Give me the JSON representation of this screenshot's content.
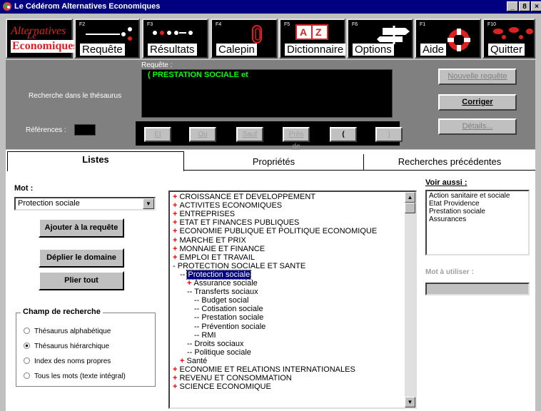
{
  "window": {
    "title": "Le Cédérom Alternatives Economiques",
    "buttons": [
      "_",
      "8",
      "×"
    ]
  },
  "toolbar": {
    "logo": {
      "top": "Alternatives",
      "bottom": "Economiques",
      "overlay": "Le Cédérom"
    },
    "items": [
      {
        "fkey": "F2",
        "label": "Requête"
      },
      {
        "fkey": "F3",
        "label": "Résultats"
      },
      {
        "fkey": "F4",
        "label": "Calepin"
      },
      {
        "fkey": "F5",
        "label": "Dictionnaire"
      },
      {
        "fkey": "F6",
        "label": "Options"
      },
      {
        "fkey": "F1",
        "label": "Aide"
      },
      {
        "fkey": "F10",
        "label": "Quitter"
      }
    ]
  },
  "query": {
    "label": "Requête :",
    "text": "(   PRESTATION SOCIALE    et",
    "thesaurus_label": "Recherche dans le thésaurus",
    "references_label": "Références :",
    "operators": [
      "Et",
      "Ou",
      "Sauf",
      "Près de",
      "(",
      ")"
    ],
    "buttons": {
      "new": "Nouvelle requête",
      "correct": "Corriger",
      "details": "Détails..."
    }
  },
  "tabs": [
    "Listes",
    "Propriétés",
    "Recherches précédentes"
  ],
  "left": {
    "mot_label": "Mot :",
    "mot_value": "Protection sociale",
    "add_button": "Ajouter à la requête",
    "expand_button": "Déplier le domaine",
    "collapse_button": "Plier tout",
    "field_title": "Champ de recherche",
    "fields": [
      {
        "label": "Thésaurus alphabétique",
        "checked": false
      },
      {
        "label": "Thésaurus hiérarchique",
        "checked": true
      },
      {
        "label": "Index des noms propres",
        "checked": false
      },
      {
        "label": "Tous les mots (texte intégral)",
        "checked": false
      }
    ]
  },
  "tree": [
    {
      "text": "CROISSANCE ET DEVELOPPEMENT",
      "prefix": "+",
      "indent": 0
    },
    {
      "text": "ACTIVITES ECONOMIQUES",
      "prefix": "+",
      "indent": 0
    },
    {
      "text": "ENTREPRISES",
      "prefix": "+",
      "indent": 0
    },
    {
      "text": "ETAT ET FINANCES PUBLIQUES",
      "prefix": "+",
      "indent": 0
    },
    {
      "text": "ECONOMIE PUBLIQUE ET POLITIQUE ECONOMIQUE",
      "prefix": "+",
      "indent": 0
    },
    {
      "text": "MARCHE ET PRIX",
      "prefix": "+",
      "indent": 0
    },
    {
      "text": "MONNAIE ET FINANCE",
      "prefix": "+",
      "indent": 0
    },
    {
      "text": "EMPLOI ET TRAVAIL",
      "prefix": "+",
      "indent": 0
    },
    {
      "text": "PROTECTION SOCIALE ET SANTE",
      "prefix": "-",
      "indent": 0
    },
    {
      "text": "Protection sociale",
      "prefix": "--",
      "indent": 1,
      "selected": true
    },
    {
      "text": "Assurance sociale",
      "prefix": "+",
      "indent": 2
    },
    {
      "text": "Transferts sociaux",
      "prefix": "--",
      "indent": 2
    },
    {
      "text": "Budget social",
      "prefix": "--",
      "indent": 3
    },
    {
      "text": "Cotisation sociale",
      "prefix": "--",
      "indent": 3
    },
    {
      "text": "Prestation sociale",
      "prefix": "--",
      "indent": 3
    },
    {
      "text": "Prévention sociale",
      "prefix": "--",
      "indent": 3
    },
    {
      "text": "RMI",
      "prefix": "--",
      "indent": 3
    },
    {
      "text": "Droits sociaux",
      "prefix": "--",
      "indent": 2
    },
    {
      "text": "Politique sociale",
      "prefix": "--",
      "indent": 2
    },
    {
      "text": "Santé",
      "prefix": "+",
      "indent": 1
    },
    {
      "text": "ECONOMIE ET RELATIONS INTERNATIONALES",
      "prefix": "+",
      "indent": 0
    },
    {
      "text": "REVENU ET CONSOMMATION",
      "prefix": "+",
      "indent": 0
    },
    {
      "text": "SCIENCE ECONOMIQUE",
      "prefix": "+",
      "indent": 0
    }
  ],
  "right": {
    "see_also_label": "Voir aussi :",
    "see_also": [
      "Action sanitaire et sociale",
      "Etat Providence",
      "Prestation sociale",
      "Assurances"
    ],
    "use_label": "Mot à utiliser :",
    "use_value": ""
  },
  "colors": {
    "title_bar": "#000080",
    "query_text": "#00ff00",
    "plus_marker": "#e00000",
    "background": "#c0c0c0"
  }
}
